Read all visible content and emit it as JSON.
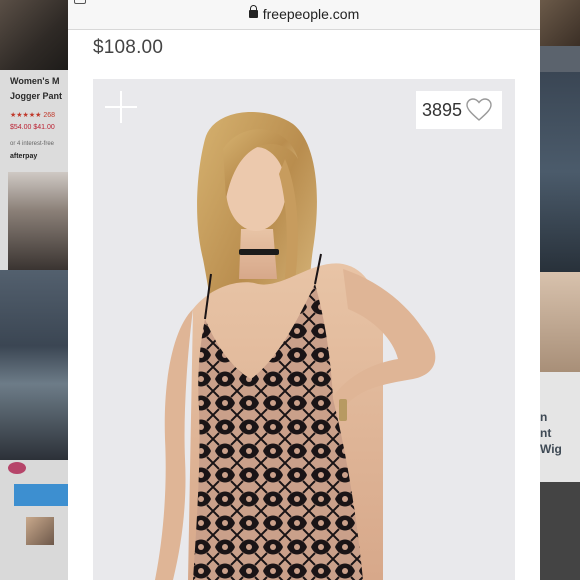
{
  "browser": {
    "url": "freepeople.com"
  },
  "product": {
    "price": "$108.00",
    "favorite_count": "3895"
  },
  "background_left": {
    "title_line1": "Women's M",
    "title_line2": "Jogger Pant",
    "rating_text": "★★★★★ 268",
    "price_text": "$54.00 $41.00",
    "installments_text": "or 4 interest-free",
    "afterpay_text": "afterpay"
  },
  "background_right": {
    "line1": "n",
    "line2": "nt",
    "line3": "Wig"
  },
  "icons": {
    "add": "plus-icon",
    "favorite": "heart-outline-icon",
    "secure": "lock-icon"
  },
  "colors": {
    "page_background": "#ffffff",
    "image_background": "#e9e9ec",
    "price_text": "#444444"
  }
}
